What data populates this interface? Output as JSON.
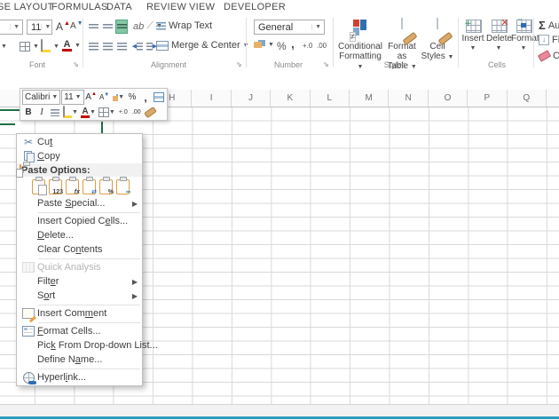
{
  "ribbon": {
    "tabs": [
      "SE LAYOUT",
      "FORMULAS",
      "DATA",
      "REVIEW",
      "VIEW",
      "DEVELOPER"
    ],
    "font_group": {
      "label": "Font",
      "font_size_value": "11"
    },
    "alignment_group": {
      "label": "Alignment",
      "wrap_text_label": "Wrap Text",
      "merge_center_label": "Merge & Center"
    },
    "number_group": {
      "label": "Number",
      "format_value": "General",
      "percent": "%",
      "comma": ",",
      "inc_decimal": "+.0",
      "dec_decimal": ".00"
    },
    "styles_group": {
      "label": "Styles",
      "buttons": [
        {
          "lines": [
            "Conditional",
            "Formatting"
          ]
        },
        {
          "lines": [
            "Format as",
            "Table"
          ]
        },
        {
          "lines": [
            "Cell",
            "Styles"
          ]
        }
      ]
    },
    "cells_group": {
      "label": "Cells",
      "buttons": [
        "Insert",
        "Delete",
        "Format"
      ]
    },
    "editing_group": {
      "sum_glyph": "Σ",
      "buttons": [
        "Aut",
        "Fill",
        "Clea"
      ]
    }
  },
  "mini_toolbar": {
    "font_name": "Calibri",
    "font_size": "11",
    "bold": "B",
    "italic": "I",
    "percent": "%",
    "comma": ",",
    "inc_decimal": "+.0",
    "dec_decimal": ".00"
  },
  "context_menu": {
    "items": [
      {
        "type": "item",
        "label": "Cut",
        "accel_index": 2,
        "icon": "scissors-icon"
      },
      {
        "type": "item",
        "label": "Copy",
        "accel_index": 0,
        "icon": "copy-icon"
      },
      {
        "type": "label",
        "label": "Paste Options:",
        "icon": "paste-icon"
      },
      {
        "type": "paste-icons",
        "icons": [
          "paste-icon",
          "paste-values-icon",
          "paste-formulas-icon",
          "paste-transpose-icon",
          "paste-formatting-icon",
          "paste-link-icon"
        ]
      },
      {
        "type": "item",
        "label": "Paste Special...",
        "accel_index": 6,
        "submenu": true
      },
      {
        "type": "sep"
      },
      {
        "type": "item",
        "label": "Insert Copied Cells...",
        "accel_index": 15
      },
      {
        "type": "item",
        "label": "Delete...",
        "accel_index": 0
      },
      {
        "type": "item",
        "label": "Clear Contents",
        "accel_index": 8
      },
      {
        "type": "sep"
      },
      {
        "type": "item",
        "label": "Quick Analysis",
        "disabled": true,
        "icon": "quick-analysis-icon"
      },
      {
        "type": "item",
        "label": "Filter",
        "accel_index": 4,
        "submenu": true
      },
      {
        "type": "item",
        "label": "Sort",
        "accel_index": 1,
        "submenu": true
      },
      {
        "type": "sep"
      },
      {
        "type": "item",
        "label": "Insert Comment",
        "accel_index": 10,
        "icon": "comment-icon"
      },
      {
        "type": "sep"
      },
      {
        "type": "item",
        "label": "Format Cells...",
        "accel_index": 0,
        "icon": "format-cells-icon"
      },
      {
        "type": "item",
        "label": "Pick From Drop-down List...",
        "accel_index": 3
      },
      {
        "type": "item",
        "label": "Define Name...",
        "accel_index": 8
      },
      {
        "type": "sep"
      },
      {
        "type": "item",
        "label": "Hyperlink...",
        "accel_index": 6,
        "icon": "hyperlink-icon"
      }
    ]
  },
  "sheet": {
    "column_headers": [
      "H",
      "I",
      "J",
      "K",
      "L",
      "M",
      "N",
      "O",
      "P",
      "Q"
    ]
  },
  "colors": {
    "accent_green": "#1e7145",
    "status_teal": "#2d9cbd",
    "grid_line": "#d9d9d9",
    "active_button_green": "#83c7a4",
    "clipboard_orange": "#dd9c45",
    "fill_yellow": "#f5d836",
    "font_color_red": "#c00000",
    "delete_red": "#d23f31"
  }
}
